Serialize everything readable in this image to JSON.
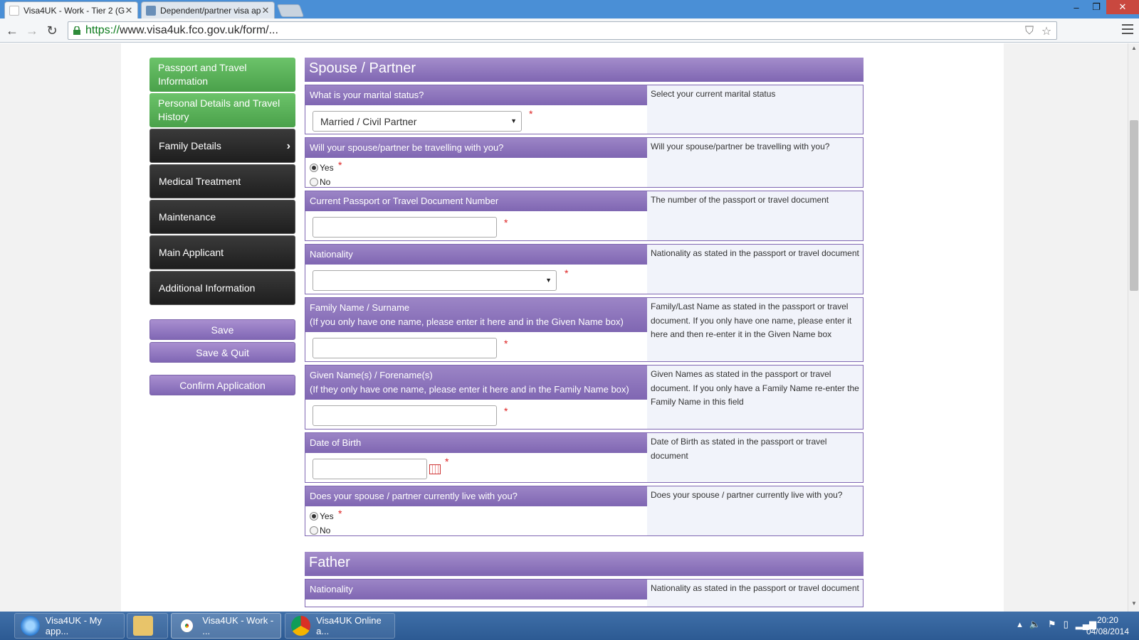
{
  "browser": {
    "tabs": [
      {
        "title": "Visa4UK - Work - Tier 2 (G",
        "active": true
      },
      {
        "title": "Dependent/partner visa ap",
        "active": false
      }
    ],
    "url_scheme": "https://",
    "url_rest": "www.visa4uk.fco.gov.uk/form/..."
  },
  "sidebar": {
    "items": [
      {
        "label": "Passport and Travel Information",
        "state": "completed"
      },
      {
        "label": "Personal Details and Travel History",
        "state": "completed"
      },
      {
        "label": "Family Details",
        "state": "current"
      },
      {
        "label": "Medical Treatment",
        "state": "pending"
      },
      {
        "label": "Maintenance",
        "state": "pending"
      },
      {
        "label": "Main Applicant",
        "state": "pending"
      },
      {
        "label": "Additional Information",
        "state": "pending"
      }
    ],
    "save_label": "Save",
    "save_quit_label": "Save & Quit",
    "confirm_label": "Confirm Application"
  },
  "form": {
    "spouse_heading": "Spouse / Partner",
    "father_heading": "Father",
    "marital": {
      "label": "What is your marital status?",
      "value": "Married / Civil Partner",
      "help": "Select your current marital status"
    },
    "travelling": {
      "label": "Will your spouse/partner be travelling with you?",
      "options": [
        "Yes",
        "No"
      ],
      "selected": "Yes",
      "help": "Will your spouse/partner be travelling with you?"
    },
    "passport": {
      "label": "Current Passport or Travel Document Number",
      "value": "",
      "help": "The number of the passport or travel document"
    },
    "nationality": {
      "label": "Nationality",
      "value": "",
      "help": "Nationality as stated in the passport or travel document"
    },
    "family_name": {
      "label": "Family Name / Surname",
      "sublabel": "(If you only have one name, please enter it here and in the Given Name box)",
      "value": "",
      "help": "Family/Last Name as stated in the passport or travel document. If you only have one name, please enter it here and then re-enter it in the Given Name box"
    },
    "given_name": {
      "label": "Given Name(s) / Forename(s)",
      "sublabel": "(If they only have one name, please enter it here and in the Family Name box)",
      "value": "",
      "help": "Given Names as stated in the passport or travel document. If you only have a Family Name re-enter the Family Name in this field"
    },
    "dob": {
      "label": "Date of Birth",
      "value": "",
      "help": "Date of Birth as stated in the passport or travel document"
    },
    "lives_with": {
      "label": "Does your spouse / partner currently live with you?",
      "options": [
        "Yes",
        "No"
      ],
      "selected": "Yes",
      "help": "Does your spouse / partner currently live with you?"
    },
    "father_nationality": {
      "label": "Nationality",
      "help": "Nationality as stated in the passport or travel document"
    },
    "required_mark": "*"
  },
  "taskbar": {
    "items": [
      {
        "label": "Visa4UK - My app...",
        "icon": "ie-icon"
      },
      {
        "label": "",
        "icon": "folder-icon"
      },
      {
        "label": "Visa4UK - Work - ...",
        "icon": "chrome-icon"
      },
      {
        "label": "Visa4UK Online a...",
        "icon": "chrome-icon"
      }
    ],
    "time": "20:20",
    "date": "04/08/2014"
  },
  "colors": {
    "accent_purple": "#7f66b2",
    "completed_green": "#4aa14a",
    "nav_dark": "#1e1e1e",
    "required_red": "#d22222"
  }
}
